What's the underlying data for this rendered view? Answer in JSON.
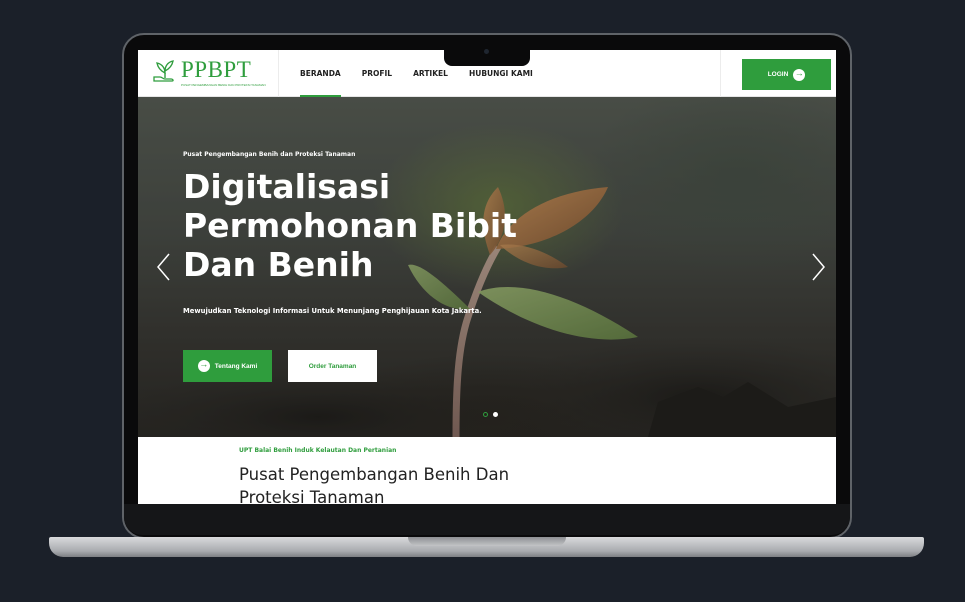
{
  "header": {
    "logo_text": "PPBPT",
    "logo_tagline": "PUSAT PENGEMBANGAN BENIH DAN PROTEKSI TANAMAN",
    "nav": [
      {
        "label": "BERANDA",
        "active": true
      },
      {
        "label": "PROFIL",
        "active": false
      },
      {
        "label": "ARTIKEL",
        "active": false
      },
      {
        "label": "HUBUNGI KAMI",
        "active": false
      }
    ],
    "login_label": "LOGIN"
  },
  "hero": {
    "eyebrow": "Pusat Pengembangan Benih dan Proteksi Tanaman",
    "title": "Digitalisasi Permohonan Bibit Dan Benih",
    "subtitle": "Mewujudkan Teknologi Informasi Untuk Menunjang Penghijauan Kota Jakarta.",
    "primary_button": "Tentang Kami",
    "secondary_button": "Order Tanaman",
    "slides_total": 2,
    "active_slide": 1
  },
  "section": {
    "eyebrow": "UPT Balai Benih Induk Kelautan Dan Pertanian",
    "title": "Pusat Pengembangan Benih Dan Proteksi Tanaman"
  },
  "colors": {
    "brand_green": "#2f9d3d",
    "background": "#1b2029"
  },
  "icons": {
    "logo": "hand-with-sprout-icon",
    "login": "arrow-right-circle-icon",
    "prev": "chevron-left-icon",
    "next": "chevron-right-icon"
  }
}
